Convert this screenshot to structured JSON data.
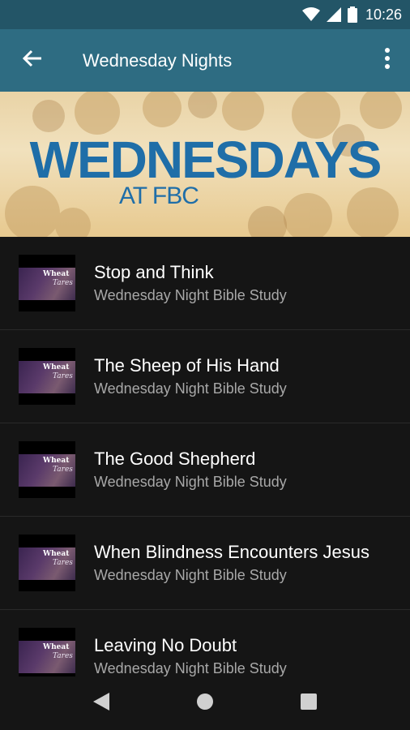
{
  "status_bar": {
    "time": "10:26",
    "icons": [
      "wifi-icon",
      "signal-icon",
      "battery-icon"
    ]
  },
  "app_bar": {
    "title": "Wednesday Nights",
    "back_icon": "arrow-left-icon",
    "menu_icon": "more-vert-icon"
  },
  "banner": {
    "headline": "WEDNESDAYS",
    "subline": "AT FBC",
    "color": "#1f6ea8"
  },
  "list": {
    "items": [
      {
        "title": "Stop and Think",
        "subtitle": "Wednesday Night Bible Study"
      },
      {
        "title": "The Sheep of His Hand",
        "subtitle": "Wednesday Night Bible Study"
      },
      {
        "title": "The Good Shepherd",
        "subtitle": "Wednesday Night Bible Study"
      },
      {
        "title": "When Blindness Encounters Jesus",
        "subtitle": "Wednesday Night Bible Study"
      },
      {
        "title": "Leaving No Doubt",
        "subtitle": "Wednesday Night Bible Study"
      }
    ]
  },
  "nav_bar": {
    "buttons": [
      "back-triangle-icon",
      "home-circle-icon",
      "recents-square-icon"
    ]
  },
  "colors": {
    "status_bar": "#235567",
    "app_bar": "#2e6c82",
    "background": "#151515"
  }
}
